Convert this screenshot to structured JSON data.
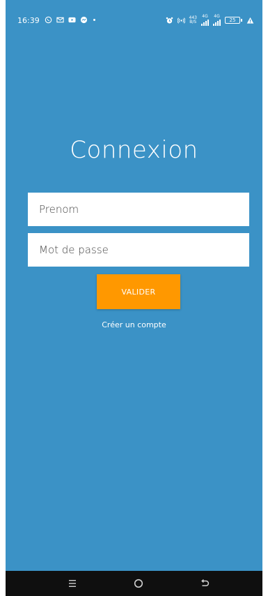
{
  "status_bar": {
    "time": "16:39",
    "left_icons": [
      "whatsapp-icon",
      "gmail-icon",
      "youtube-icon",
      "messenger-icon"
    ],
    "data_speed_value": "443",
    "data_speed_unit": "B/S",
    "network_1": "4G",
    "network_2": "4G",
    "battery_level": "25"
  },
  "login": {
    "title": "Connexion",
    "first_name_placeholder": "Prenom",
    "password_placeholder": "Mot de passe",
    "submit_label": "VALIDER",
    "create_account_label": "Créer un compte"
  },
  "colors": {
    "background": "#3b92c6",
    "button": "#ff9800",
    "nav_bar": "#0f0f0f"
  }
}
